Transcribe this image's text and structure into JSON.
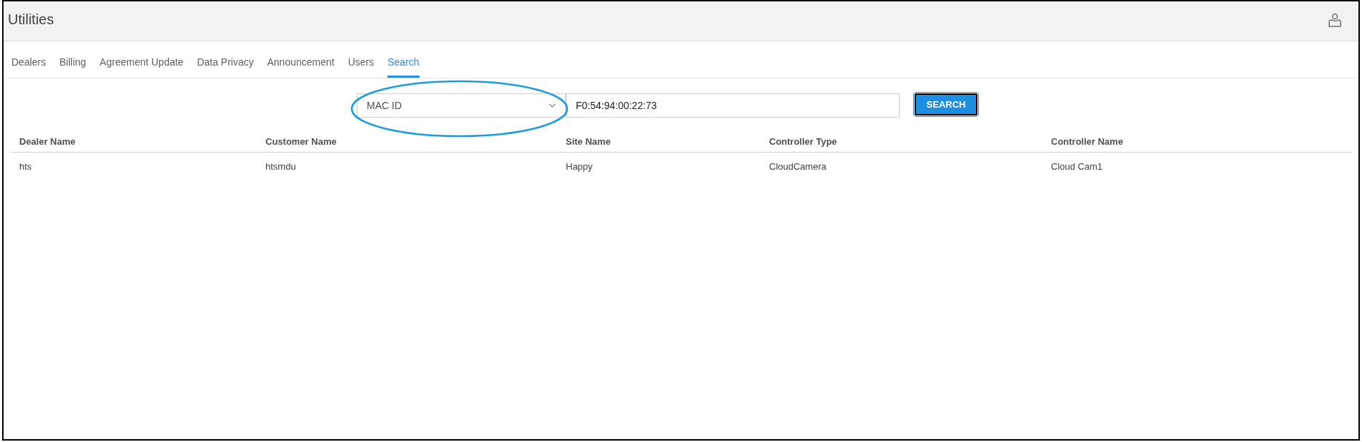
{
  "header": {
    "title": "Utilities"
  },
  "tabs": [
    {
      "label": "Dealers",
      "selected": false
    },
    {
      "label": "Billing",
      "selected": false
    },
    {
      "label": "Agreement Update",
      "selected": false
    },
    {
      "label": "Data Privacy",
      "selected": false
    },
    {
      "label": "Announcement",
      "selected": false
    },
    {
      "label": "Users",
      "selected": false
    },
    {
      "label": "Search",
      "selected": true
    }
  ],
  "search": {
    "field_type": "MAC ID",
    "value": "F0:54:94:00:22:73",
    "button": "SEARCH"
  },
  "table": {
    "columns": [
      "Dealer Name",
      "Customer Name",
      "Site Name",
      "Controller Type",
      "Controller Name"
    ],
    "rows": [
      [
        "hts",
        "htsmdu",
        "Happy",
        "CloudCamera",
        "Cloud Cam1"
      ]
    ]
  }
}
